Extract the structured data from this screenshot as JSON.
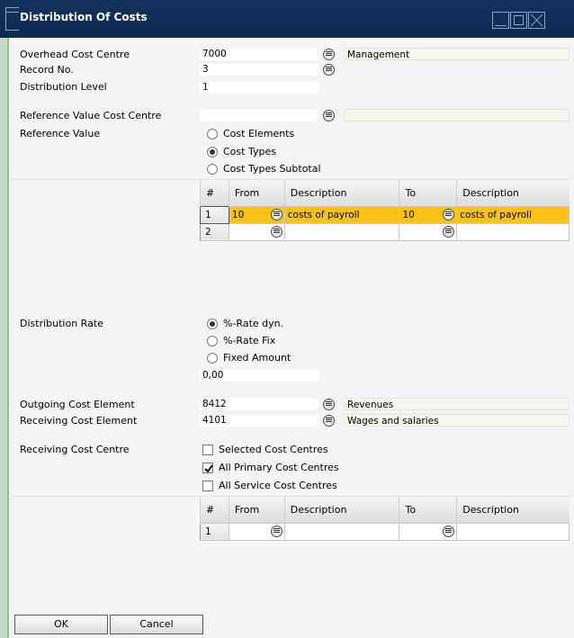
{
  "window": {
    "title": "Distribution Of Costs"
  },
  "overhead_cost_centre": {
    "label": "Overhead Cost Centre",
    "value": "7000",
    "description": "Management"
  },
  "record_no": {
    "label": "Record No.",
    "value": "3"
  },
  "distribution_level": {
    "label": "Distribution Level",
    "value": "1"
  },
  "reference_value_cost_centre": {
    "label": "Reference Value Cost Centre",
    "value": "",
    "description": ""
  },
  "reference_value": {
    "label": "Reference Value",
    "options": [
      "Cost Elements",
      "Cost Types",
      "Cost Types Subtotal"
    ],
    "selected": "Cost Types"
  },
  "ref_grid": {
    "headers": [
      "#",
      "From",
      "Description",
      "To",
      "Description"
    ],
    "rows": [
      {
        "num": "1",
        "from": "10",
        "from_desc": "costs of payroll",
        "to": "10",
        "to_desc": "costs of payroll",
        "selected": true
      },
      {
        "num": "2",
        "from": "",
        "from_desc": "",
        "to": "",
        "to_desc": "",
        "selected": false
      }
    ]
  },
  "distribution_rate": {
    "label": "Distribution Rate",
    "options": [
      "%-Rate dyn.",
      "%-Rate Fix",
      "Fixed Amount"
    ],
    "selected": "%-Rate dyn.",
    "amount": "0,00"
  },
  "outgoing_cost_element": {
    "label": "Outgoing Cost Element",
    "value": "8412",
    "description": "Revenues"
  },
  "receiving_cost_element": {
    "label": "Receiving Cost Element",
    "value": "4101",
    "description": "Wages and salaries"
  },
  "receiving_cost_centre": {
    "label": "Receiving Cost Centre",
    "options": [
      {
        "label": "Selected Cost Centres",
        "checked": false
      },
      {
        "label": "All Primary Cost Centres",
        "checked": true
      },
      {
        "label": "All Service Cost Centres",
        "checked": false
      }
    ]
  },
  "centre_grid": {
    "headers": [
      "#",
      "From",
      "Description",
      "To",
      "Description"
    ],
    "rows": [
      {
        "num": "1",
        "from": "",
        "from_desc": "",
        "to": "",
        "to_desc": ""
      }
    ]
  },
  "buttons": {
    "ok": "OK",
    "cancel": "Cancel"
  },
  "colors": {
    "title_bar": "#0d2a52",
    "selected_row": "#fdc21a",
    "left_accent": "#c6d9c4"
  }
}
